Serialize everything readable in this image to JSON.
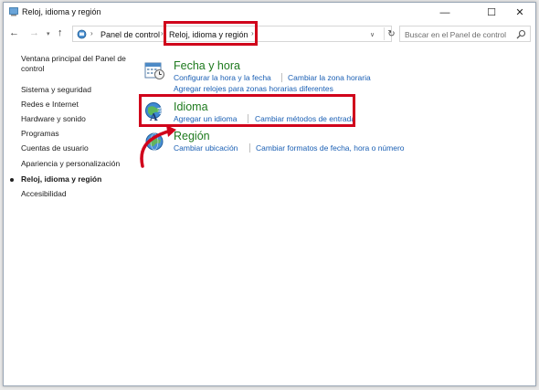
{
  "window": {
    "title": "Reloj, idioma y región",
    "minimize_glyph": "—",
    "maximize_glyph": "☐",
    "close_glyph": "✕"
  },
  "address": {
    "back_glyph": "←",
    "forward_glyph": "→",
    "recent_glyph": "▾",
    "up_glyph": "↑",
    "crumb_separator": "›",
    "crumbs": [
      "Panel de control",
      "Reloj, idioma y región"
    ],
    "dropdown_glyph": "∨",
    "refresh_glyph": "↻",
    "search_placeholder": "Buscar en el Panel de control"
  },
  "sidebar": {
    "items": [
      {
        "label": "Ventana principal del Panel de control"
      },
      {
        "label": "Sistema y seguridad"
      },
      {
        "label": "Redes e Internet"
      },
      {
        "label": "Hardware y sonido"
      },
      {
        "label": "Programas"
      },
      {
        "label": "Cuentas de usuario"
      },
      {
        "label": "Apariencia y personalización"
      },
      {
        "label": "Reloj, idioma y región"
      },
      {
        "label": "Accesibilidad"
      }
    ]
  },
  "categories": [
    {
      "title": "Fecha y hora",
      "icon": "calendar-clock-icon",
      "links": [
        "Configurar la hora y la fecha",
        "Cambiar la zona horaria",
        "Agregar relojes para zonas horarias diferentes"
      ]
    },
    {
      "title": "Idioma",
      "icon": "language-globe-icon",
      "links": [
        "Agregar un idioma",
        "Cambiar métodos de entrada"
      ]
    },
    {
      "title": "Región",
      "icon": "region-globe-icon",
      "links": [
        "Cambiar ubicación",
        "Cambiar formatos de fecha, hora o número"
      ]
    }
  ],
  "colors": {
    "highlight": "#d0021b",
    "category_title": "#1e7a1e",
    "link": "#1a5fb4"
  }
}
